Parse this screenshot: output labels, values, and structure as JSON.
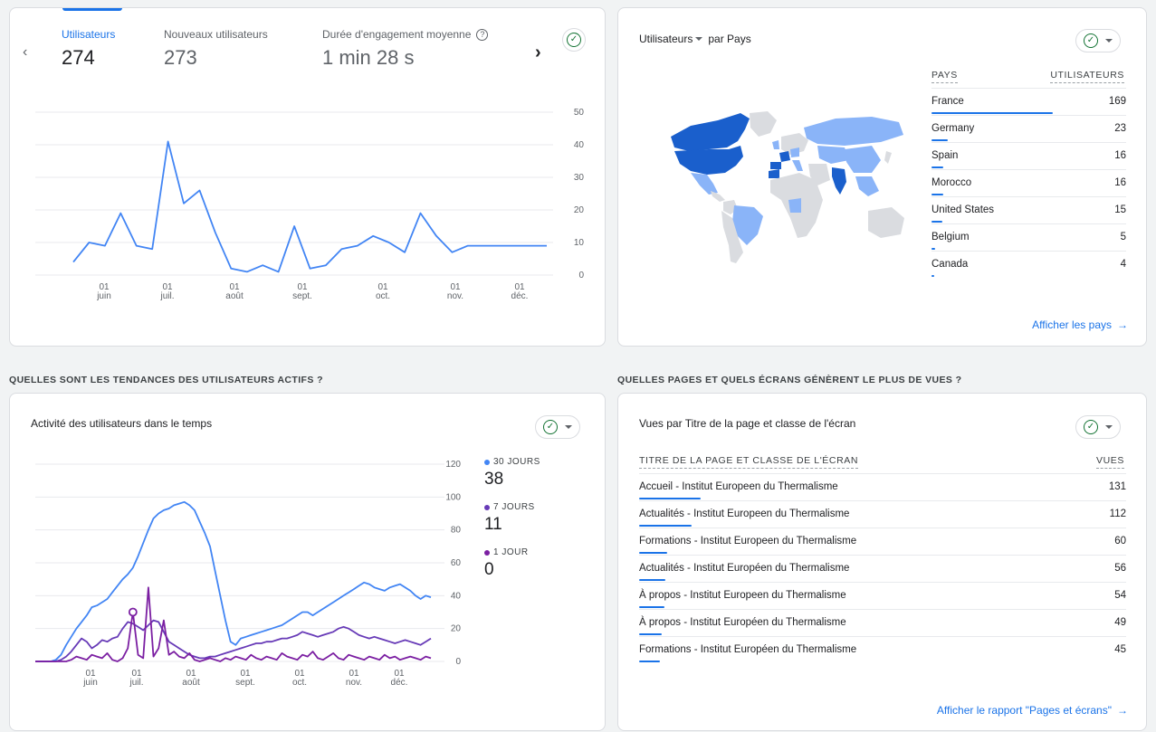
{
  "top_left": {
    "metrics": [
      {
        "label": "Utilisateurs",
        "value": "274"
      },
      {
        "label": "Nouveaux utilisateurs",
        "value": "273"
      },
      {
        "label": "Durée d'engagement moyenne",
        "value": "1 min 28 s"
      }
    ],
    "help_icon": "help-circle-icon",
    "prev_icon": "chevron-left-icon",
    "next_icon": "chevron-right-icon"
  },
  "chart_data": [
    {
      "type": "line",
      "series": [
        {
          "values": [
            4,
            10,
            9,
            19,
            9,
            8,
            41,
            22,
            26,
            13,
            2,
            1,
            3,
            1,
            15,
            2,
            3,
            8,
            9,
            12,
            10,
            7,
            19,
            12,
            7,
            9,
            9,
            9,
            9,
            9,
            9
          ]
        }
      ],
      "x_ticks": [
        "01\njuin",
        "01\njuil.",
        "01\naoût",
        "01\nsept.",
        "01\noct.",
        "01\nnov.",
        "01\ndéc."
      ],
      "y_ticks": [
        "50",
        "40",
        "30",
        "20",
        "10",
        "0"
      ],
      "ylim": [
        0,
        50
      ],
      "color": "#4285f4"
    },
    {
      "type": "line",
      "series": [
        {
          "name": "30 JOURS",
          "color": "#4285f4",
          "values": [
            0,
            0,
            0,
            0,
            1,
            4,
            10,
            15,
            20,
            24,
            28,
            33,
            34,
            36,
            38,
            42,
            46,
            50,
            53,
            57,
            64,
            72,
            80,
            87,
            90,
            92,
            93,
            95,
            96,
            97,
            95,
            92,
            85,
            78,
            70,
            55,
            40,
            25,
            12,
            10,
            14,
            15,
            16,
            17,
            18,
            19,
            20,
            21,
            22,
            24,
            26,
            28,
            30,
            30,
            28,
            30,
            32,
            34,
            36,
            38,
            40,
            42,
            44,
            46,
            48,
            47,
            45,
            44,
            43,
            45,
            46,
            47,
            45,
            43,
            40,
            38,
            40,
            39
          ]
        },
        {
          "name": "7 JOURS",
          "color": "#673ab7",
          "values": [
            0,
            0,
            0,
            0,
            0,
            1,
            3,
            6,
            10,
            14,
            12,
            8,
            10,
            13,
            12,
            14,
            15,
            20,
            24,
            23,
            21,
            19,
            22,
            25,
            24,
            18,
            12,
            10,
            8,
            6,
            4,
            3,
            2,
            2,
            3,
            3,
            4,
            5,
            6,
            7,
            8,
            9,
            10,
            11,
            11,
            12,
            12,
            13,
            14,
            14,
            15,
            16,
            18,
            17,
            16,
            15,
            16,
            17,
            18,
            20,
            21,
            20,
            18,
            16,
            15,
            14,
            15,
            14,
            13,
            12,
            11,
            12,
            13,
            12,
            11,
            10,
            12,
            14
          ]
        },
        {
          "name": "1 JOUR",
          "color": "#7b1fa2",
          "values": [
            0,
            0,
            0,
            0,
            0,
            0,
            0,
            1,
            3,
            2,
            1,
            4,
            3,
            2,
            5,
            1,
            0,
            2,
            8,
            30,
            4,
            2,
            45,
            3,
            8,
            25,
            4,
            6,
            3,
            2,
            5,
            1,
            0,
            1,
            2,
            1,
            0,
            2,
            1,
            3,
            2,
            1,
            4,
            2,
            1,
            3,
            2,
            1,
            5,
            3,
            2,
            1,
            4,
            3,
            6,
            2,
            1,
            3,
            5,
            2,
            1,
            4,
            3,
            2,
            1,
            3,
            2,
            1,
            4,
            2,
            3,
            1,
            2,
            3,
            2,
            1,
            3,
            2
          ]
        }
      ],
      "x_ticks": [
        "01\njuin",
        "01\njuil.",
        "01\naoût",
        "01\nsept.",
        "01\noct.",
        "01\nnov.",
        "01\ndéc."
      ],
      "y_ticks": [
        "120",
        "100",
        "80",
        "60",
        "40",
        "20",
        "0"
      ],
      "ylim": [
        0,
        120
      ]
    }
  ],
  "countries_card": {
    "title": "Utilisateurs",
    "title_suffix": "par Pays",
    "col_country": "PAYS",
    "col_users": "UTILISATEURS",
    "rows": [
      {
        "label": "France",
        "value": "169",
        "frac": 1.0
      },
      {
        "label": "Germany",
        "value": "23",
        "frac": 0.136
      },
      {
        "label": "Spain",
        "value": "16",
        "frac": 0.095
      },
      {
        "label": "Morocco",
        "value": "16",
        "frac": 0.095
      },
      {
        "label": "United States",
        "value": "15",
        "frac": 0.089
      },
      {
        "label": "Belgium",
        "value": "5",
        "frac": 0.03
      },
      {
        "label": "Canada",
        "value": "4",
        "frac": 0.024
      }
    ],
    "link": "Afficher les pays"
  },
  "sections": {
    "active_users": "QUELLES SONT LES TENDANCES DES UTILISATEURS ACTIFS ?",
    "pages": "QUELLES PAGES ET QUELS ÉCRANS GÉNÈRENT LE PLUS DE VUES ?"
  },
  "activity_card": {
    "title": "Activité des utilisateurs dans le temps",
    "legend": [
      {
        "label": "30 JOURS",
        "value": "38",
        "color": "#4285f4"
      },
      {
        "label": "7 JOURS",
        "value": "11",
        "color": "#673ab7"
      },
      {
        "label": "1 JOUR",
        "value": "0",
        "color": "#7b1fa2"
      }
    ]
  },
  "pages_card": {
    "title": "Vues par Titre de la page et classe de l'écran",
    "col_title": "TITRE DE LA PAGE ET CLASSE DE L'ÉCRAN",
    "col_views": "VUES",
    "rows": [
      {
        "label": "Accueil - Institut Europeen du Thermalisme",
        "value": "131",
        "frac": 1.0
      },
      {
        "label": "Actualités - Institut Europeen du Thermalisme",
        "value": "112",
        "frac": 0.855
      },
      {
        "label": "Formations - Institut Europeen du Thermalisme",
        "value": "60",
        "frac": 0.458
      },
      {
        "label": "Actualités - Institut Européen du Thermalisme",
        "value": "56",
        "frac": 0.427
      },
      {
        "label": "À propos - Institut Europeen du Thermalisme",
        "value": "54",
        "frac": 0.412
      },
      {
        "label": "À propos - Institut Européen du Thermalisme",
        "value": "49",
        "frac": 0.374
      },
      {
        "label": "Formations - Institut Européen du Thermalisme",
        "value": "45",
        "frac": 0.344
      }
    ],
    "link": "Afficher le rapport \"Pages et écrans\""
  }
}
